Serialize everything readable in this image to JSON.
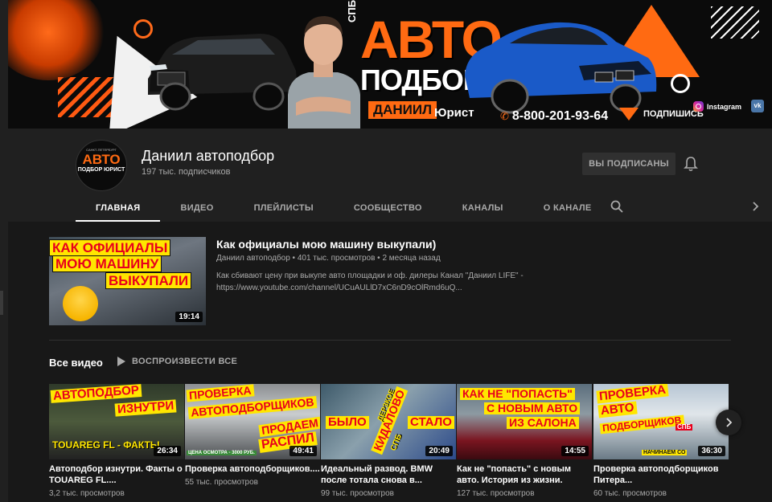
{
  "banner": {
    "spb": "СПБ",
    "avto": "АВТО",
    "podbor": "ПОДБОР",
    "daniil": "ДАНИИЛ",
    "yurist": "Юрист",
    "phone": "8-800-201-93-64",
    "subscribe": "ПОДПИШИСЬ",
    "instagram": "Instagram",
    "vk": "vk"
  },
  "channel": {
    "avatar_small": "САНКТ-ПЕТЕРБУРГ",
    "avatar_top": "АВТО",
    "avatar_bottom": "ПОДБОР ЮРИСТ",
    "name": "Даниил автоподбор",
    "subscribers": "197 тыс. подписчиков",
    "subscribed_label": "ВЫ ПОДПИСАНЫ"
  },
  "tabs": [
    {
      "label": "ГЛАВНАЯ",
      "active": true
    },
    {
      "label": "ВИДЕО"
    },
    {
      "label": "ПЛЕЙЛИСТЫ"
    },
    {
      "label": "СООБЩЕСТВО"
    },
    {
      "label": "КАНАЛЫ"
    },
    {
      "label": "О КАНАЛЕ"
    }
  ],
  "featured": {
    "thumb_lines": [
      "КАК ОФИЦИАЛЫ",
      "МОЮ МАШИНУ",
      "ВЫКУПАЛИ"
    ],
    "duration": "19:14",
    "title": "Как официалы мою машину выкупали)",
    "meta": "Даниил автоподбор • 401 тыс. просмотров • 2 месяца назад",
    "description": "Как сбивают цену при выкупе авто площадки и оф. дилеры Канал \"Даниил LIFE\" - https://www.youtube.com/channel/UCuAULlD7xC6nD9cOlRmd6uQ..."
  },
  "section": {
    "title": "Все видео",
    "play_all": "ВОСПРОИЗВЕСТИ ВСЕ"
  },
  "videos": [
    {
      "thumb_a": "АВТОПОДБОР",
      "thumb_b": "ИЗНУТРИ",
      "thumb_c": "TOUAREG FL - ФАКТЫ",
      "duration": "26:34",
      "title": "Автоподбор изнутри. Факты о TOUAREG FL....",
      "views": "3,2 тыс. просмотров"
    },
    {
      "thumb_a": "ПРОВЕРКА",
      "thumb_b": "АВТОПОДБОРЩИКОВ",
      "thumb_c": "ПРОДАЕМ",
      "thumb_d": "РАСПИЛ",
      "thumb_e": "ЦЕНА ОСМОТРА - 3000 РУБ.",
      "duration": "49:41",
      "title": "Проверка автоподборщиков....",
      "views": "55 тыс. просмотров"
    },
    {
      "thumb_a": "БЫЛО",
      "thumb_b": "СТАЛО",
      "thumb_c": "КИДАЛОВО",
      "thumb_d": "ДЕРЗКОЕ",
      "thumb_e": "СПБ",
      "duration": "20:49",
      "title": "Идеальный развод. BMW после тотала снова в...",
      "views": "99 тыс. просмотров"
    },
    {
      "thumb_a": "КАК НЕ \"ПОПАСТЬ\"",
      "thumb_b": "С НОВЫМ АВТО",
      "thumb_c": "ИЗ САЛОНА",
      "duration": "14:55",
      "title": "Как не \"попасть\" с новым авто. История из жизни.",
      "views": "127 тыс. просмотров"
    },
    {
      "thumb_a": "ПРОВЕРКА",
      "thumb_b": "АВТО",
      "thumb_c": "ПОДБОРЩИКОВ",
      "thumb_d": "СПБ",
      "thumb_e": "НАЧИНАЕМ СО",
      "duration": "36:30",
      "title": "Проверка автоподборщиков Питера...",
      "views": "60 тыс. просмотров"
    }
  ],
  "icons": {
    "bell": "bell-icon",
    "search": "search-icon",
    "next": "chevron-right-icon",
    "play": "play-icon"
  },
  "colors": {
    "background": "#181818",
    "header": "#202020",
    "accent_orange": "#ff6a12",
    "thumb_yellow": "#ffe600",
    "thumb_red": "#e8001c"
  }
}
